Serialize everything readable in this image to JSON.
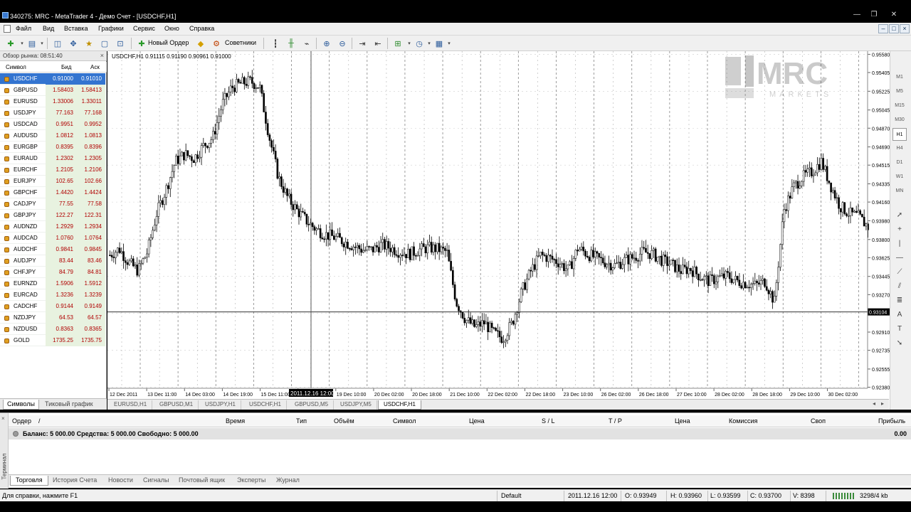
{
  "window": {
    "title": "340275: MRC - MetaTrader 4 - Демо Счет - [USDCHF,H1]"
  },
  "menu": [
    "Файл",
    "Вид",
    "Вставка",
    "Графики",
    "Сервис",
    "Окно",
    "Справка"
  ],
  "toolbar": {
    "new_order_label": "Новый Ордер",
    "advisors_label": "Советники"
  },
  "market_watch": {
    "header": "Обзор рынка: 08:51:40",
    "col_symbol": "Символ",
    "col_bid": "Бид",
    "col_ask": "Аск",
    "rows": [
      {
        "symbol": "USDCHF",
        "bid": "0.91000",
        "ask": "0.91010"
      },
      {
        "symbol": "GBPUSD",
        "bid": "1.58403",
        "ask": "1.58413"
      },
      {
        "symbol": "EURUSD",
        "bid": "1.33006",
        "ask": "1.33011"
      },
      {
        "symbol": "USDJPY",
        "bid": "77.163",
        "ask": "77.168"
      },
      {
        "symbol": "USDCAD",
        "bid": "0.9951",
        "ask": "0.9952"
      },
      {
        "symbol": "AUDUSD",
        "bid": "1.0812",
        "ask": "1.0813"
      },
      {
        "symbol": "EURGBP",
        "bid": "0.8395",
        "ask": "0.8396"
      },
      {
        "symbol": "EURAUD",
        "bid": "1.2302",
        "ask": "1.2305"
      },
      {
        "symbol": "EURCHF",
        "bid": "1.2105",
        "ask": "1.2106"
      },
      {
        "symbol": "EURJPY",
        "bid": "102.65",
        "ask": "102.66"
      },
      {
        "symbol": "GBPCHF",
        "bid": "1.4420",
        "ask": "1.4424"
      },
      {
        "symbol": "CADJPY",
        "bid": "77.55",
        "ask": "77.58"
      },
      {
        "symbol": "GBPJPY",
        "bid": "122.27",
        "ask": "122.31"
      },
      {
        "symbol": "AUDNZD",
        "bid": "1.2929",
        "ask": "1.2934"
      },
      {
        "symbol": "AUDCAD",
        "bid": "1.0760",
        "ask": "1.0764"
      },
      {
        "symbol": "AUDCHF",
        "bid": "0.9841",
        "ask": "0.9845"
      },
      {
        "symbol": "AUDJPY",
        "bid": "83.44",
        "ask": "83.46"
      },
      {
        "symbol": "CHFJPY",
        "bid": "84.79",
        "ask": "84.81"
      },
      {
        "symbol": "EURNZD",
        "bid": "1.5906",
        "ask": "1.5912"
      },
      {
        "symbol": "EURCAD",
        "bid": "1.3236",
        "ask": "1.3239"
      },
      {
        "symbol": "CADCHF",
        "bid": "0.9144",
        "ask": "0.9149"
      },
      {
        "symbol": "NZDJPY",
        "bid": "64.53",
        "ask": "64.57"
      },
      {
        "symbol": "NZDUSD",
        "bid": "0.8363",
        "ask": "0.8365"
      },
      {
        "symbol": "GOLD",
        "bid": "1735.25",
        "ask": "1735.75"
      }
    ],
    "tabs": [
      "Символы",
      "Тиковый график"
    ]
  },
  "chart": {
    "info": "USDCHF,H1  0.91115 0.91190 0.90961 0.91000",
    "watermark_brand": "MRC",
    "watermark_sub": "MARKETS",
    "crosshair_price": "0.93104",
    "crosshair_time": "2011.12.16 12:00",
    "tabs": [
      "EURUSD,H1",
      "GBPUSD,M1",
      "USDJPY,H1",
      "USDCHF,H1",
      "GBPUSD,M5",
      "USDJPY,M5",
      "USDCHF,H1"
    ],
    "active_tab_index": 6
  },
  "chart_data": {
    "type": "candlestick",
    "symbol": "USDCHF",
    "timeframe": "H1",
    "y_ticks": [
      "0.95580",
      "0.95405",
      "0.95225",
      "0.95045",
      "0.94870",
      "0.94690",
      "0.94515",
      "0.94335",
      "0.94160",
      "0.93980",
      "0.93800",
      "0.93625",
      "0.93445",
      "0.93270",
      "0.93090",
      "0.92910",
      "0.92735",
      "0.92555",
      "0.92380"
    ],
    "x_ticks": [
      "12 Dec 2011",
      "13 Dec 11:00",
      "14 Dec 03:00",
      "14 Dec 19:00",
      "15 Dec 11:00",
      "16 Dec 03:00",
      "19 Dec 10:00",
      "20 Dec 02:00",
      "20 Dec 18:00",
      "21 Dec 10:00",
      "22 Dec 02:00",
      "22 Dec 18:00",
      "23 Dec 10:00",
      "26 Dec 02:00",
      "26 Dec 18:00",
      "27 Dec 10:00",
      "28 Dec 02:00",
      "28 Dec 18:00",
      "29 Dec 10:00",
      "30 Dec 02:00"
    ],
    "ylim": [
      0.9237,
      0.9561
    ],
    "close_path": [
      0.9365,
      0.9371,
      0.9358,
      0.935,
      0.9368,
      0.9405,
      0.9428,
      0.9455,
      0.9462,
      0.9458,
      0.947,
      0.9478,
      0.951,
      0.9526,
      0.953,
      0.9532,
      0.9527,
      0.948,
      0.944,
      0.942,
      0.9408,
      0.9398,
      0.939,
      0.9385,
      0.9382,
      0.9378,
      0.9374,
      0.937,
      0.937,
      0.9375,
      0.9372,
      0.9368,
      0.9366,
      0.937,
      0.9372,
      0.9371,
      0.9368,
      0.932,
      0.9303,
      0.9296,
      0.93,
      0.929,
      0.9285,
      0.93,
      0.933,
      0.935,
      0.9365,
      0.9362,
      0.9358,
      0.935,
      0.9372,
      0.9366,
      0.9362,
      0.9358,
      0.9355,
      0.936,
      0.9363,
      0.9368,
      0.9366,
      0.936,
      0.9356,
      0.935,
      0.9352,
      0.9345,
      0.934,
      0.9343,
      0.9345,
      0.934,
      0.9338,
      0.9336,
      0.934,
      0.932,
      0.9408,
      0.943,
      0.944,
      0.9445,
      0.9455,
      0.9432,
      0.9412,
      0.9405,
      0.9402,
      0.9392
    ],
    "last_price": "0.91000",
    "ohlc_readout": {
      "open": "O: 0.93949",
      "high": "H: 0.93960",
      "low": "L: 0.93599",
      "close": "C: 0.93700",
      "volume": "V: 8398"
    }
  },
  "timeframes": [
    "M1",
    "M5",
    "M15",
    "M30",
    "H1",
    "H4",
    "D1",
    "W1",
    "MN"
  ],
  "terminal": {
    "side_label": "Терминал",
    "columns": [
      "Ордер",
      "/",
      "Время",
      "Тип",
      "Объём",
      "Символ",
      "Цена",
      "S / L",
      "T / P",
      "Цена",
      "Комиссия",
      "Своп",
      "Прибыль"
    ],
    "balance_line": "Баланс: 5 000.00  Средства: 5 000.00  Свободно: 5 000.00",
    "profit": "0.00",
    "tabs": [
      "Торговля",
      "История Счета",
      "Новости",
      "Сигналы",
      "Почтовый ящик",
      "Эксперты",
      "Журнал"
    ]
  },
  "status": {
    "help": "Для справки, нажмите F1",
    "profile": "Default",
    "datetime": "2011.12.16 12:00",
    "open": "O: 0.93949",
    "high": "H: 0.93960",
    "low": "L: 0.93599",
    "close": "C: 0.93700",
    "volume": "V: 8398",
    "traffic": "3298/4 kb"
  },
  "colors": {
    "selected_row": "#3374d0",
    "price_red": "#b00000",
    "candle": "#000000",
    "grid": "#c8c8c8"
  }
}
